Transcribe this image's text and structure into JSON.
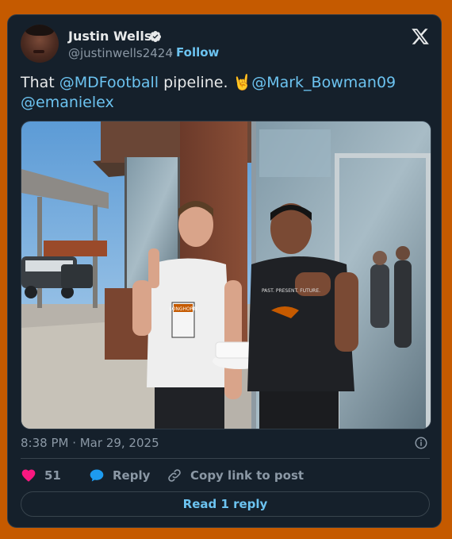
{
  "author": {
    "name": "Justin Wells",
    "handle": "@justinwells2424",
    "follow_label": "Follow",
    "verified": true
  },
  "tweet": {
    "text_prefix": "That ",
    "mention_1": "@MDFootball",
    "text_middle": " pipeline. ",
    "emoji": "🤘",
    "mention_2": "@Mark_Bowman09",
    "mention_3": "@emanielex"
  },
  "photo": {
    "shirt_text_left_logo": "LONGHORN",
    "shirt_text_right": "PAST. PRESENT. FUTURE."
  },
  "timestamp": "8:38 PM · Mar 29, 2025",
  "actions": {
    "likes": "51",
    "reply_label": "Reply",
    "copy_label": "Copy link to post"
  },
  "read_reply_label": "Read 1 reply",
  "colors": {
    "background": "#c55a00",
    "card": "#15202b",
    "accent": "#6cc3f0",
    "like": "#f91880"
  }
}
